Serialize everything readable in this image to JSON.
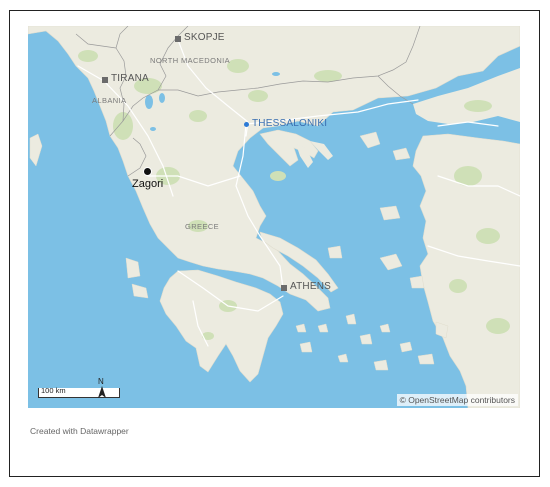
{
  "map": {
    "cities": [
      {
        "name": "SKOPJE"
      },
      {
        "name": "TIRANA"
      },
      {
        "name": "THESSALONIKI"
      },
      {
        "name": "ATHENS"
      }
    ],
    "countries": [
      "NORTH MACEDONIA",
      "ALBANIA",
      "GREECE"
    ],
    "marker": {
      "label": "Zagori"
    },
    "scale": {
      "label": "100 km"
    },
    "north": "N",
    "attribution": "© OpenStreetMap contributors",
    "colors": {
      "sea": "#7cc0e5",
      "land": "#ecebe0",
      "green": "#cfe0b7",
      "road": "#ffffff"
    }
  },
  "footer": {
    "credit": "Created with Datawrapper"
  }
}
